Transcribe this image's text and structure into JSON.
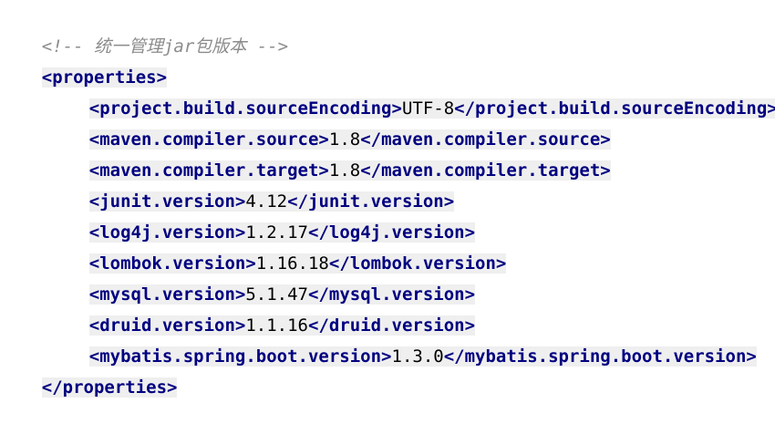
{
  "editor": {
    "comment": "<!-- 统一管理jar包版本 -->",
    "properties_open": "<properties>",
    "properties_close": "</properties>",
    "lines": [
      {
        "open": "<project.build.sourceEncoding>",
        "value": "UTF-8",
        "close": "</project.build.sourceEncoding>"
      },
      {
        "open": "<maven.compiler.source>",
        "value": "1.8",
        "close": "</maven.compiler.source>"
      },
      {
        "open": "<maven.compiler.target>",
        "value": "1.8",
        "close": "</maven.compiler.target>"
      },
      {
        "open": "<junit.version>",
        "value": "4.12",
        "close": "</junit.version>"
      },
      {
        "open": "<log4j.version>",
        "value": "1.2.17",
        "close": "</log4j.version>"
      },
      {
        "open": "<lombok.version>",
        "value": "1.16.18",
        "close": "</lombok.version>"
      },
      {
        "open": "<mysql.version>",
        "value": "5.1.47",
        "close": "</mysql.version>"
      },
      {
        "open": "<druid.version>",
        "value": "1.1.16",
        "close": "</druid.version>"
      },
      {
        "open": "<mybatis.spring.boot.version>",
        "value": "1.3.0",
        "close": "</mybatis.spring.boot.version>"
      }
    ]
  }
}
